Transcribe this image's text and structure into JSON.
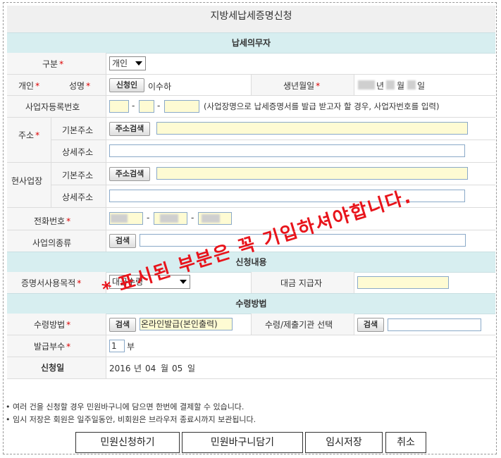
{
  "title": "지방세납세증명신청",
  "sections": {
    "taxpayer": "납세의무자",
    "content": "신청내용",
    "receive": "수령방법"
  },
  "required_mark": "*",
  "taxpayer": {
    "type_label": "구분",
    "type_value": "개인",
    "individual_label": "개인",
    "name_label": "성명",
    "name_button": "신청인",
    "name_value": "이수하",
    "birth_label": "생년월일",
    "birth_year_unit": "년",
    "birth_month_unit": "월",
    "birth_day_unit": "일",
    "bizreg_label": "사업자등록번호",
    "bizreg_sep": "-",
    "bizreg_hint": "(사업장명으로 납세증명서를 발급 받고자 할 경우, 사업자번호를 입력)",
    "address_label": "주소",
    "basic_address_label": "기본주소",
    "detail_address_label": "상세주소",
    "address_search_button": "주소검색",
    "workplace_label": "현사업장",
    "phone_label": "전화번호",
    "phone_sep": "-",
    "business_type_label": "사업의종류",
    "search_button": "검색"
  },
  "content": {
    "purpose_label": "증명서사용목적",
    "purpose_value": "대금수령",
    "payer_label": "대금 지급자"
  },
  "receive": {
    "method_label": "수령방법",
    "method_value": "온라인발급(본인출력)",
    "institution_label": "수령/제출기관 선택",
    "copies_label": "발급부수",
    "copies_value": "1",
    "copies_unit": "부",
    "date_label": "신청일",
    "date_year": "2016",
    "date_year_unit": "년",
    "date_month": "04",
    "date_month_unit": "월",
    "date_day": "05",
    "date_day_unit": "일"
  },
  "notes": [
    "• 여러 건을 신청할 경우 민원바구니에 담으면 한번에 결제할 수 있습니다.",
    "• 임시 저장은 회원은 일주일동안, 비회원은 브라우저 종료시까지 보관됩니다."
  ],
  "buttons": {
    "apply": "민원신청하기",
    "cart": "민원바구니담기",
    "temp_save": "임시저장",
    "cancel": "취소"
  },
  "overlay": {
    "star": "*",
    "text": "표시된 부분은 꼭 기입하셔야합니다."
  },
  "colors": {
    "section_bg": "#d7eef0",
    "required": "#dd0000",
    "overlay": "#e8141b",
    "input_highlight": "#fefbd3"
  }
}
